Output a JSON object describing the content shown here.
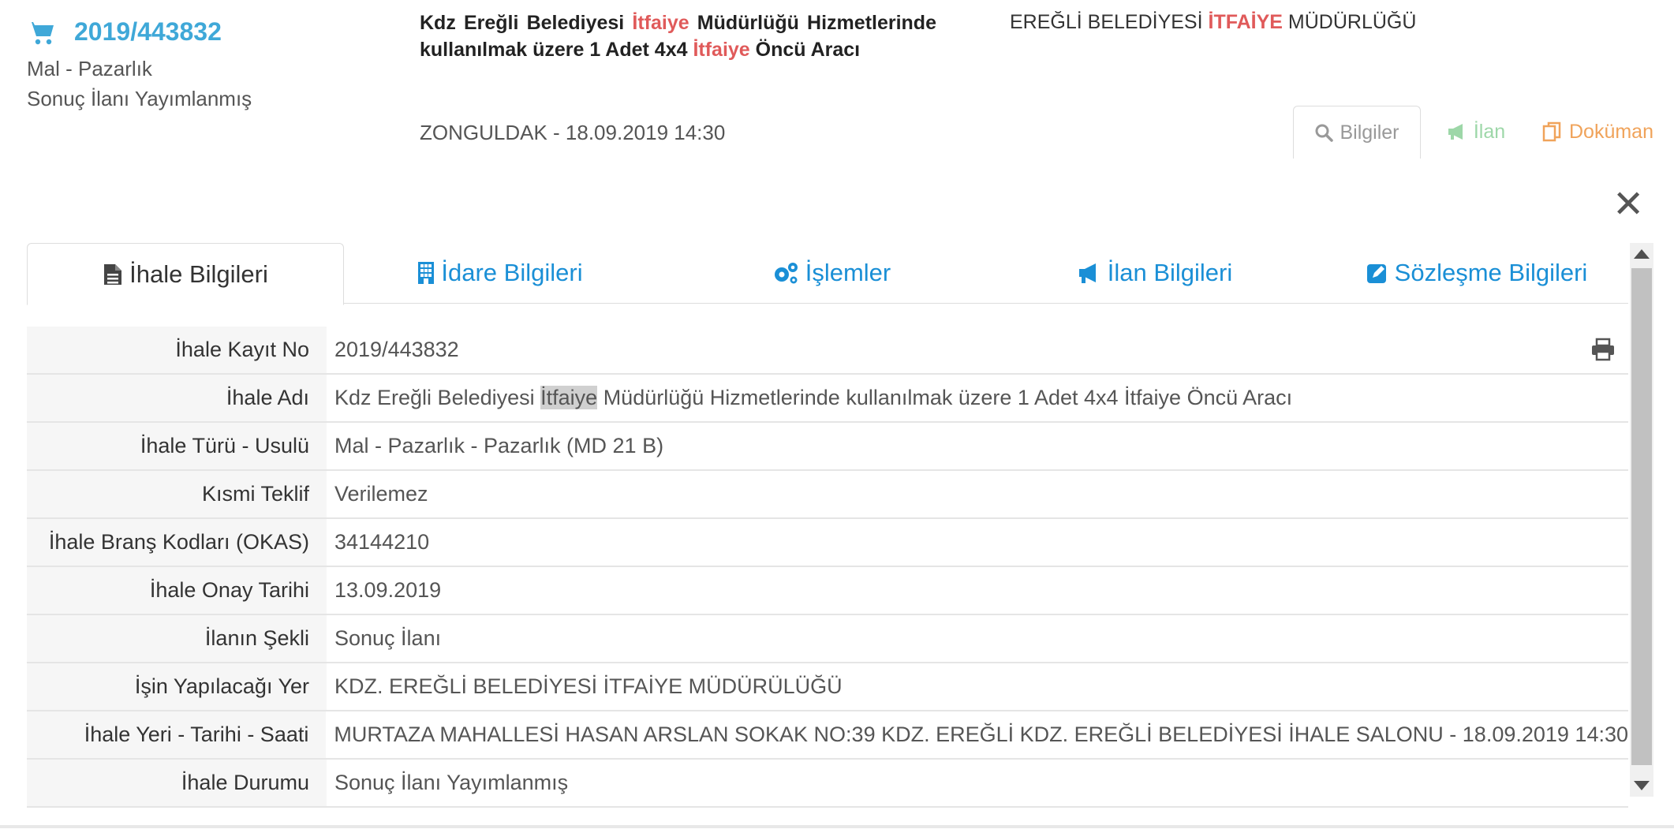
{
  "header": {
    "ihale_no": "2019/443832",
    "type": "Mal - Pazarlık",
    "status": "Sonuç İlanı Yayımlanmış",
    "title_parts": [
      "Kdz Ereğli Belediyesi ",
      "İtfaiye",
      " Müdürlüğü Hizmetlerinde kullanılmak üzere 1 Adet 4x4 ",
      "İtfaiye",
      " Öncü Aracı"
    ],
    "location_date": "ZONGULDAK - 18.09.2019 14:30",
    "org_parts": [
      "EREĞLİ BELEDİYESİ ",
      "İTFAİYE",
      " MÜDÜRLÜĞÜ"
    ]
  },
  "top_buttons": {
    "bilgiler": "Bilgiler",
    "ilan": "İlan",
    "dokuman": "Doküman"
  },
  "close_label": "✕",
  "tabs": [
    {
      "label": "İhale Bilgileri"
    },
    {
      "label": "İdare Bilgileri"
    },
    {
      "label": "İşlemler"
    },
    {
      "label": "İlan Bilgileri"
    },
    {
      "label": "Sözleşme Bilgileri"
    }
  ],
  "rows": {
    "kayit_no": {
      "label": "İhale Kayıt No",
      "value": "2019/443832"
    },
    "adi": {
      "label": "İhale Adı",
      "value_parts": [
        "Kdz Ereğli Belediyesi ",
        "İtfaiye",
        " Müdürlüğü Hizmetlerinde kullanılmak üzere 1 Adet 4x4 İtfaiye Öncü Aracı"
      ]
    },
    "turu": {
      "label": "İhale Türü - Usulü",
      "value": "Mal - Pazarlık - Pazarlık (MD 21 B)"
    },
    "kismi": {
      "label": "Kısmi Teklif",
      "value": "Verilemez"
    },
    "okas": {
      "label": "İhale Branş Kodları (OKAS)",
      "value": "34144210"
    },
    "onay": {
      "label": "İhale Onay Tarihi",
      "value": "13.09.2019"
    },
    "sekil": {
      "label": "İlanın Şekli",
      "value": "Sonuç İlanı"
    },
    "yer": {
      "label": "İşin Yapılacağı Yer",
      "value": "KDZ. EREĞLİ BELEDİYESİ İTFAİYE MÜDÜRÜLÜĞÜ"
    },
    "yer_tarih": {
      "label": "İhale Yeri - Tarihi - Saati",
      "value": "MURTAZA MAHALLESİ HASAN ARSLAN SOKAK NO:39 KDZ. EREĞLİ KDZ. EREĞLİ BELEDİYESİ İHALE SALONU - 18.09.2019 14:30"
    },
    "durum": {
      "label": "İhale Durumu",
      "value": "Sonuç İlanı Yayımlanmış"
    }
  },
  "colors": {
    "accent": "#3fa8d8",
    "link": "#1a8fd6",
    "highlight": "#e05a5a",
    "ilan": "#9dd7a8",
    "dokuman": "#f0a35a"
  }
}
